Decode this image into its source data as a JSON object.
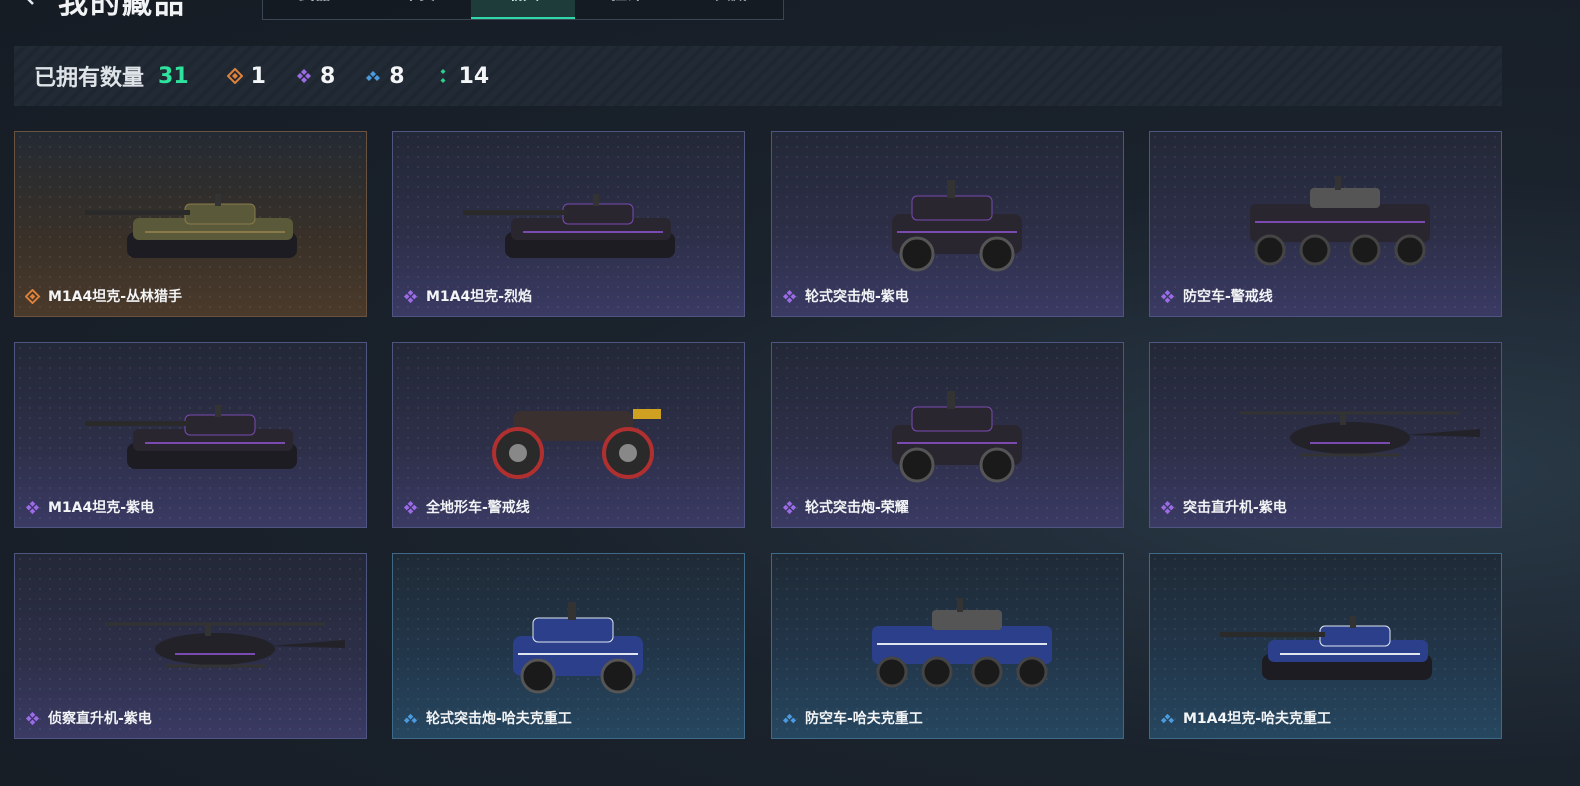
{
  "header": {
    "title": "我的藏品",
    "tabs": [
      {
        "label": "武器",
        "active": false
      },
      {
        "label": "干员",
        "active": false
      },
      {
        "label": "载具",
        "active": true
      },
      {
        "label": "挂饰",
        "active": false
      },
      {
        "label": "典藏",
        "active": false
      }
    ]
  },
  "summary": {
    "label": "已拥有数量",
    "total": "31",
    "rarities": [
      {
        "icon": "orange-diamond-icon",
        "color": "#e0823a",
        "count": "1"
      },
      {
        "icon": "purple-diamond-icon",
        "color": "#9b6be8",
        "count": "8"
      },
      {
        "icon": "blue-diamond-icon",
        "color": "#4a9be0",
        "count": "8"
      },
      {
        "icon": "green-dots-icon",
        "color": "#2ecf8e",
        "count": "14"
      }
    ]
  },
  "cards": [
    {
      "name": "M1A4坦克-丛林猎手",
      "rarity": "orange",
      "vehicle": "tank"
    },
    {
      "name": "M1A4坦克-烈焰",
      "rarity": "purple",
      "vehicle": "tank"
    },
    {
      "name": "轮式突击炮-紫电",
      "rarity": "purple",
      "vehicle": "car"
    },
    {
      "name": "防空车-警戒线",
      "rarity": "purple",
      "vehicle": "apc"
    },
    {
      "name": "M1A4坦克-紫电",
      "rarity": "purple",
      "vehicle": "tank"
    },
    {
      "name": "全地形车-警戒线",
      "rarity": "purple",
      "vehicle": "atv"
    },
    {
      "name": "轮式突击炮-荣耀",
      "rarity": "purple",
      "vehicle": "car"
    },
    {
      "name": "突击直升机-紫电",
      "rarity": "purple",
      "vehicle": "heli"
    },
    {
      "name": "侦察直升机-紫电",
      "rarity": "purple",
      "vehicle": "heli"
    },
    {
      "name": "轮式突击炮-哈夫克重工",
      "rarity": "blue",
      "vehicle": "car"
    },
    {
      "name": "防空车-哈夫克重工",
      "rarity": "blue",
      "vehicle": "apc"
    },
    {
      "name": "M1A4坦克-哈夫克重工",
      "rarity": "blue",
      "vehicle": "tank"
    }
  ],
  "colors": {
    "accent": "#2fd8a8",
    "orange": "#e0823a",
    "purple": "#9b6be8",
    "blue": "#4a9be0"
  }
}
